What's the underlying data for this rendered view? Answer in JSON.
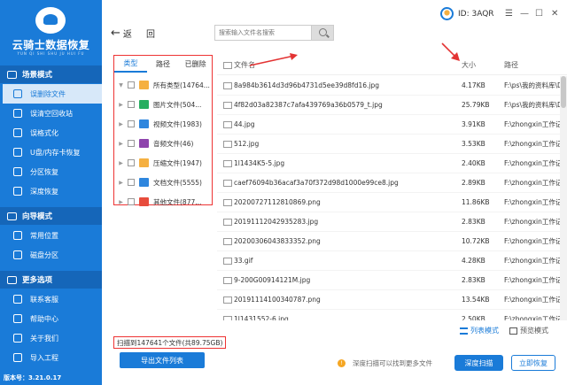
{
  "app": {
    "title": "云骑士数据恢复",
    "subtitle": "YUN QI SHI SHU JU HUI FU",
    "version": "版本号：3.21.0.17"
  },
  "sidebar": {
    "sections": [
      {
        "title": "场景模式",
        "items": [
          {
            "label": "误删除文件",
            "icon": "trash-icon",
            "active": true
          },
          {
            "label": "误清空回收站",
            "icon": "recycle-bin-icon",
            "active": false
          },
          {
            "label": "误格式化",
            "icon": "format-icon",
            "active": false
          },
          {
            "label": "U盘/内存卡恢复",
            "icon": "usb-icon",
            "active": false
          },
          {
            "label": "分区恢复",
            "icon": "partition-icon",
            "active": false
          },
          {
            "label": "深度恢复",
            "icon": "deep-icon",
            "active": false
          }
        ]
      },
      {
        "title": "向导模式",
        "items": [
          {
            "label": "常用位置",
            "icon": "location-icon",
            "active": false
          },
          {
            "label": "磁盘分区",
            "icon": "disk-icon",
            "active": false
          }
        ]
      },
      {
        "title": "更多选项",
        "items": [
          {
            "label": "联系客服",
            "icon": "service-icon",
            "active": false
          },
          {
            "label": "帮助中心",
            "icon": "help-icon",
            "active": false
          },
          {
            "label": "关于我们",
            "icon": "info-icon",
            "active": false
          },
          {
            "label": "导入工程",
            "icon": "import-icon",
            "active": false
          }
        ]
      }
    ]
  },
  "topbar": {
    "back_label": "返",
    "refresh_label": "回",
    "search_placeholder": "搜索输入文件名搜索",
    "user_id": "ID: 3AQR",
    "window_controls": [
      "☰",
      "—",
      "☐",
      "✕"
    ]
  },
  "categories": {
    "tabs": [
      "类型",
      "路径",
      "已删除"
    ],
    "active_tab": 0,
    "items": [
      {
        "label": "所有类型(14764...",
        "icon": "folder-icon",
        "color": "#f5b041",
        "expandable": true,
        "expanded": true
      },
      {
        "label": "图片文件(504...",
        "icon": "image-icon",
        "color": "#27ae60",
        "expandable": true,
        "expanded": false
      },
      {
        "label": "视频文件(1983)",
        "icon": "video-icon",
        "color": "#2e86de",
        "expandable": true,
        "expanded": false
      },
      {
        "label": "音频文件(46)",
        "icon": "audio-icon",
        "color": "#8e44ad",
        "expandable": true,
        "expanded": false
      },
      {
        "label": "压缩文件(1947)",
        "icon": "archive-icon",
        "color": "#f5b041",
        "expandable": true,
        "expanded": false
      },
      {
        "label": "文档文件(5555)",
        "icon": "document-icon",
        "color": "#2e86de",
        "expandable": true,
        "expanded": false
      },
      {
        "label": "其他文件(877...",
        "icon": "other-icon",
        "color": "#e74c3c",
        "expandable": true,
        "expanded": false
      }
    ]
  },
  "file_list": {
    "columns": {
      "name": "文件名",
      "size": "大小",
      "path": "路径"
    },
    "rows": [
      {
        "name": "8a984b3614d3d96b4731d5ee39d8fd16.jpg",
        "size": "4.17KB",
        "path": "F:\\ps\\我的资料库\\D"
      },
      {
        "name": "4f82d03a82387c7afa439769a36b0579_t.jpg",
        "size": "25.79KB",
        "path": "F:\\ps\\我的资料库\\D"
      },
      {
        "name": "44.jpg",
        "size": "3.91KB",
        "path": "F:\\zhongxin工作记"
      },
      {
        "name": "512.jpg",
        "size": "3.53KB",
        "path": "F:\\zhongxin工作记"
      },
      {
        "name": "1l1434K5-5.jpg",
        "size": "2.40KB",
        "path": "F:\\zhongxin工作记"
      },
      {
        "name": "caef76094b36acaf3a70f372d98d1000e99ce8.jpg",
        "size": "2.89KB",
        "path": "F:\\zhongxin工作记"
      },
      {
        "name": "20200727112810869.png",
        "size": "11.86KB",
        "path": "F:\\zhongxin工作记"
      },
      {
        "name": "20191112042935283.jpg",
        "size": "2.83KB",
        "path": "F:\\zhongxin工作记"
      },
      {
        "name": "20200306043833352.png",
        "size": "10.72KB",
        "path": "F:\\zhongxin工作记"
      },
      {
        "name": "33.gif",
        "size": "4.28KB",
        "path": "F:\\zhongxin工作记"
      },
      {
        "name": "9-200G00914121M.jpg",
        "size": "2.83KB",
        "path": "F:\\zhongxin工作记"
      },
      {
        "name": "20191114100340787.png",
        "size": "13.54KB",
        "path": "F:\\zhongxin工作记"
      },
      {
        "name": "1l1431552-6.jpg",
        "size": "2.50KB",
        "path": "F:\\zhongxin工作记"
      }
    ]
  },
  "footer": {
    "view_list": "列表模式",
    "view_thumb": "预览模式",
    "scan_summary": "扫描到147641个文件(共89.75GB)",
    "export_button": "导出文件列表",
    "deep_tip": "深度扫描可以找到更多文件",
    "deep_button": "深度扫描",
    "recover_button": "立即恢复"
  },
  "colors": {
    "brand": "#1a7bd8",
    "sidebar_section": "#1566b9",
    "annotation": "#e33333"
  }
}
